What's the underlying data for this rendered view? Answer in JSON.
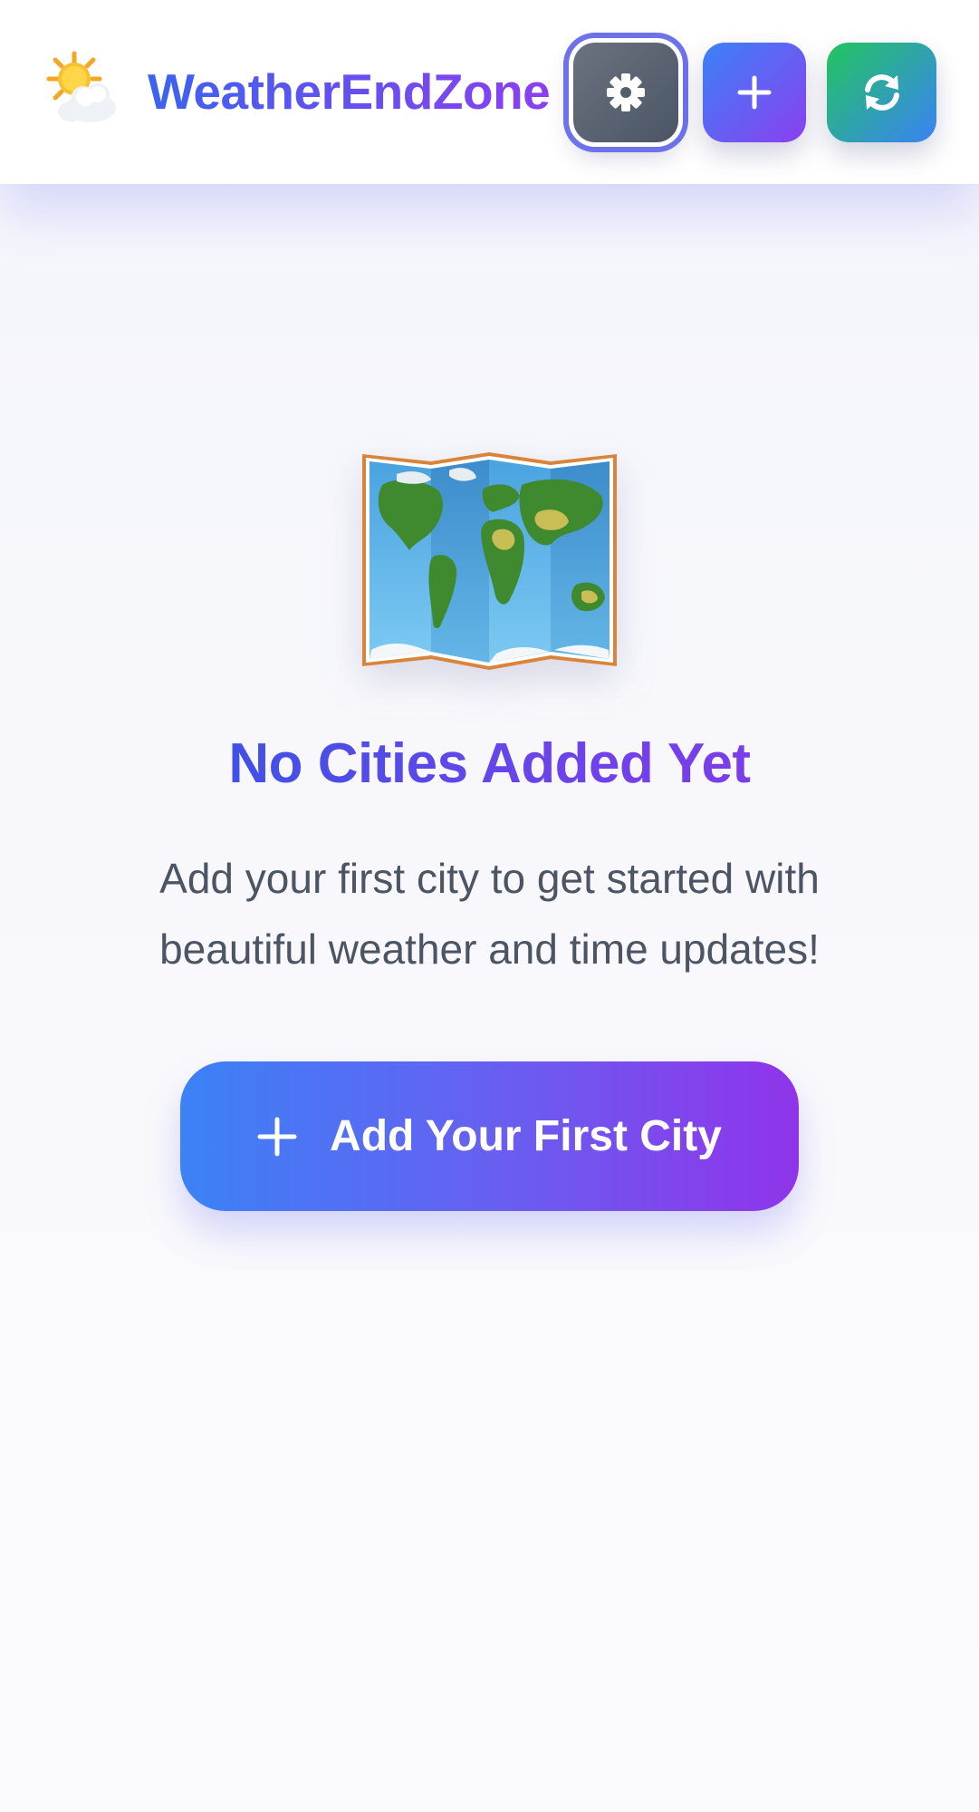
{
  "header": {
    "app_title": "WeatherEndZone",
    "logo_icon": "sun-behind-cloud-icon",
    "buttons": {
      "settings": {
        "icon": "gear-icon",
        "color": "#4b5563"
      },
      "add": {
        "icon": "plus-icon",
        "color": "#6366f1"
      },
      "refresh": {
        "icon": "refresh-icon",
        "color": "#22c55e"
      }
    }
  },
  "empty_state": {
    "icon": "world-map-icon",
    "title": "No Cities Added Yet",
    "description": "Add your first city to get started with beautiful weather and time updates!",
    "cta_label": "Add Your First City",
    "cta_icon": "plus-icon"
  },
  "colors": {
    "accent_blue": "#3b82f6",
    "accent_purple": "#8b3ff0",
    "text_muted": "#4b5563"
  }
}
